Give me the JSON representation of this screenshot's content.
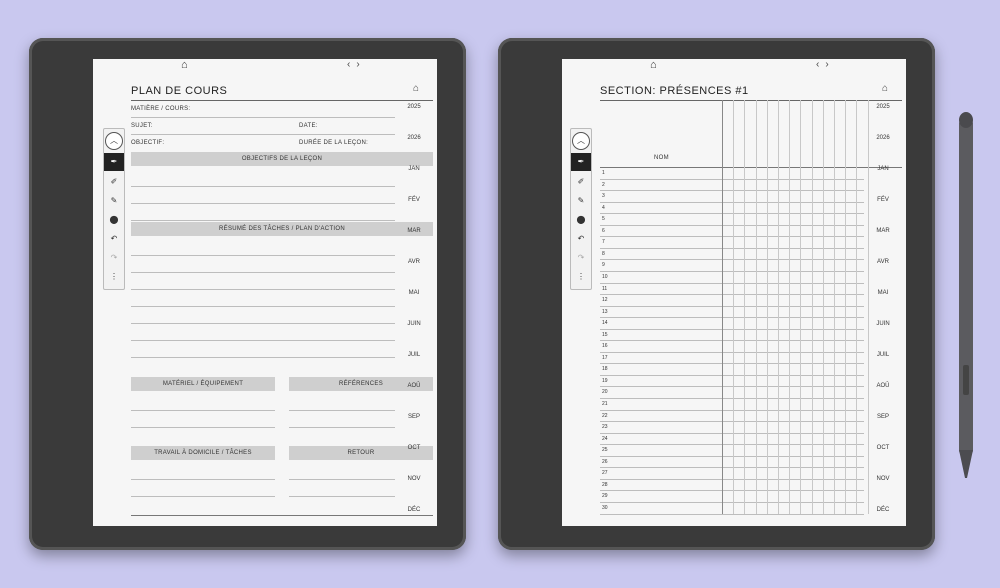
{
  "devices": [
    {
      "title": "PLAN DE COURS",
      "fields": {
        "matiere": "MATIÈRE / COURS:",
        "sujet": "SUJET:",
        "date": "DATE:",
        "objectif": "OBJECTIF:",
        "duree": "DURÉE DE LA LEÇON:"
      },
      "headers": {
        "objectifs": "OBJECTIFS DE LA LEÇON",
        "resume": "RÉSUMÉ DES TÂCHES / PLAN D'ACTION",
        "materiel": "MATÉRIEL / ÉQUIPEMENT",
        "references": "RÉFÉRENCES",
        "travail": "TRAVAIL À DOMICILE / TÂCHES",
        "retour": "RETOUR"
      }
    },
    {
      "title": "SECTION: PRÉSENCES #1",
      "nom_label": "NOM",
      "row_numbers": [
        "1",
        "2",
        "3",
        "4",
        "5",
        "6",
        "7",
        "8",
        "9",
        "10",
        "11",
        "12",
        "13",
        "14",
        "15",
        "16",
        "17",
        "18",
        "19",
        "20",
        "21",
        "22",
        "23",
        "24",
        "25",
        "26",
        "27",
        "28",
        "29",
        "30"
      ]
    }
  ],
  "side_index": [
    "2025",
    "2026",
    "JAN",
    "FÉV",
    "MAR",
    "AVR",
    "MAI",
    "JUIN",
    "JUIL",
    "AOÛ",
    "SEP",
    "OCT",
    "NOV",
    "DÉC"
  ],
  "icons": {
    "home": "⌂",
    "prev": "‹",
    "next": "›",
    "toolbar_up": "︿",
    "toolbar_tools": [
      "✒",
      "✐",
      "✎",
      "⬤",
      "↶",
      "↷",
      "⋮"
    ]
  }
}
